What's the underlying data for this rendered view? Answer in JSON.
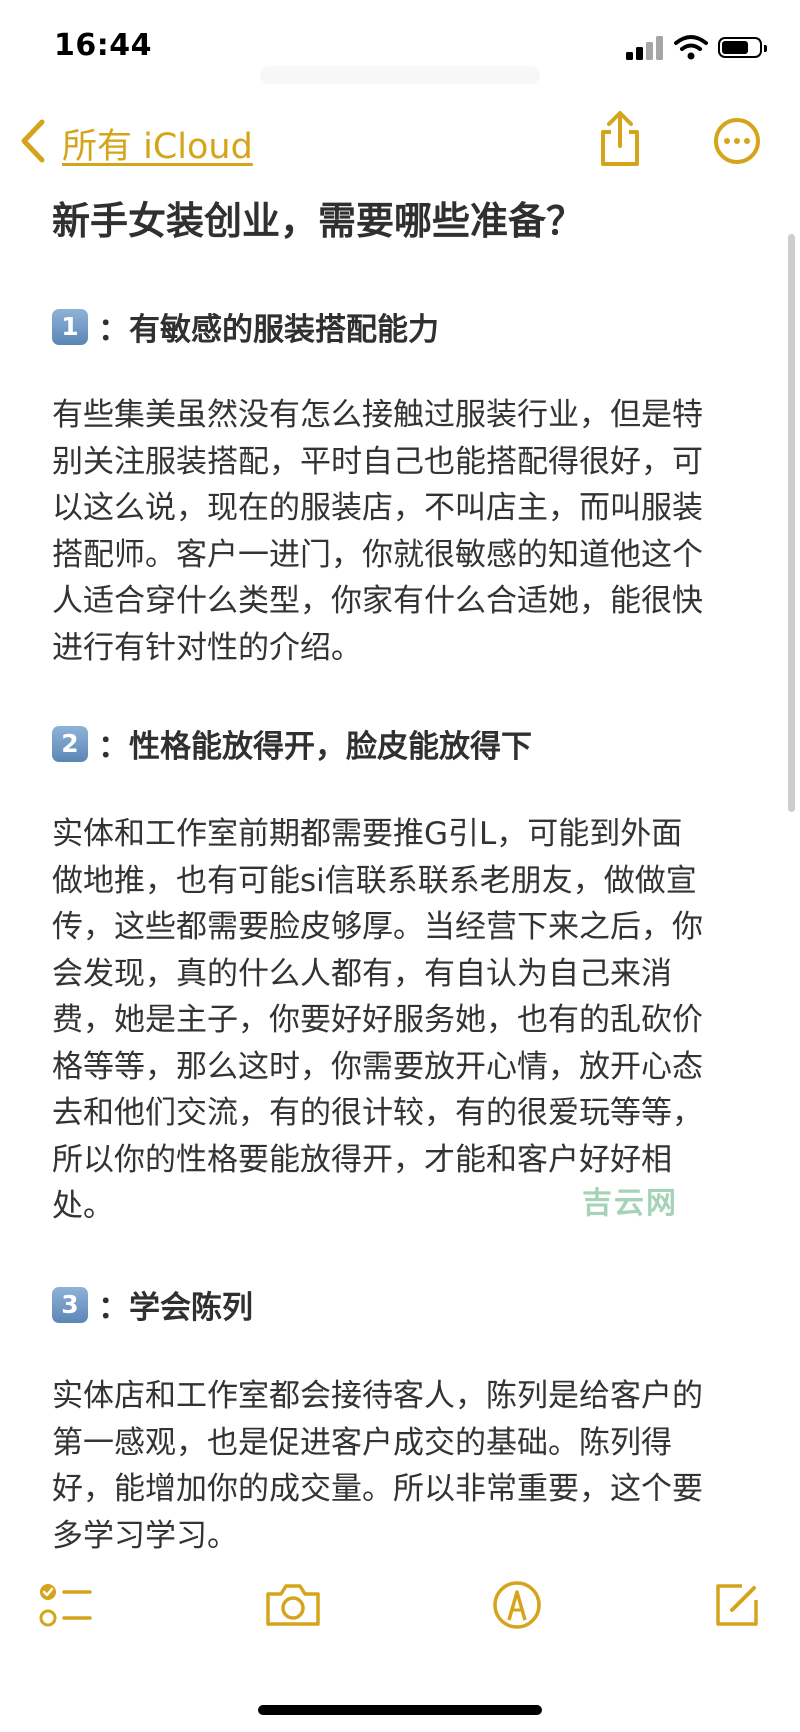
{
  "status_bar": {
    "time": "16:44"
  },
  "nav": {
    "back_label": "所有 iCloud"
  },
  "note": {
    "title": "新手女装创业，需要哪些准备？",
    "sections": [
      {
        "badge": "1",
        "heading": "：有敏感的服装搭配能力",
        "lines": [
          "有些集美虽然没有怎么接触过服装行业，但是特",
          "别关注服装搭配，平时自己也能搭配得很好，可",
          "以这么说，现在的服装店，不叫店主，而叫服装",
          "搭配师。客户一进门，你就很敏感的知道他这个",
          "人适合穿什么类型，你家有什么合适她，能很快",
          "进行有针对性的介绍。"
        ]
      },
      {
        "badge": "2",
        "heading": "：性格能放得开，脸皮能放得下",
        "lines": [
          "实体和工作室前期都需要推G引L，可能到外面",
          "做地推，也有可能si信联系联系老朋友，做做宣",
          "传，这些都需要脸皮够厚。当经营下来之后，你",
          "会发现，真的什么人都有，有自认为自己来消",
          "费，她是主子，你要好好服务她，也有的乱砍价",
          "格等等，那么这时，你需要放开心情，放开心态",
          "去和他们交流，有的很计较，有的很爱玩等等，",
          "所以你的性格要能放得开，才能和客户好好相",
          "处。"
        ]
      },
      {
        "badge": "3",
        "heading": "：学会陈列",
        "lines": [
          "实体店和工作室都会接待客人，陈列是给客户的",
          "第一感观，也是促进客户成交的基础。陈列得",
          "好，能增加你的成交量。所以非常重要，这个要",
          "多学习学习。"
        ]
      }
    ]
  },
  "watermark": "吉云网",
  "toolbar": {
    "items": [
      "checklist-icon",
      "camera-icon",
      "markup-icon",
      "compose-icon"
    ]
  },
  "colors": {
    "accent": "#d6a41b",
    "text": "#303030",
    "badge": "#6f95c2"
  }
}
